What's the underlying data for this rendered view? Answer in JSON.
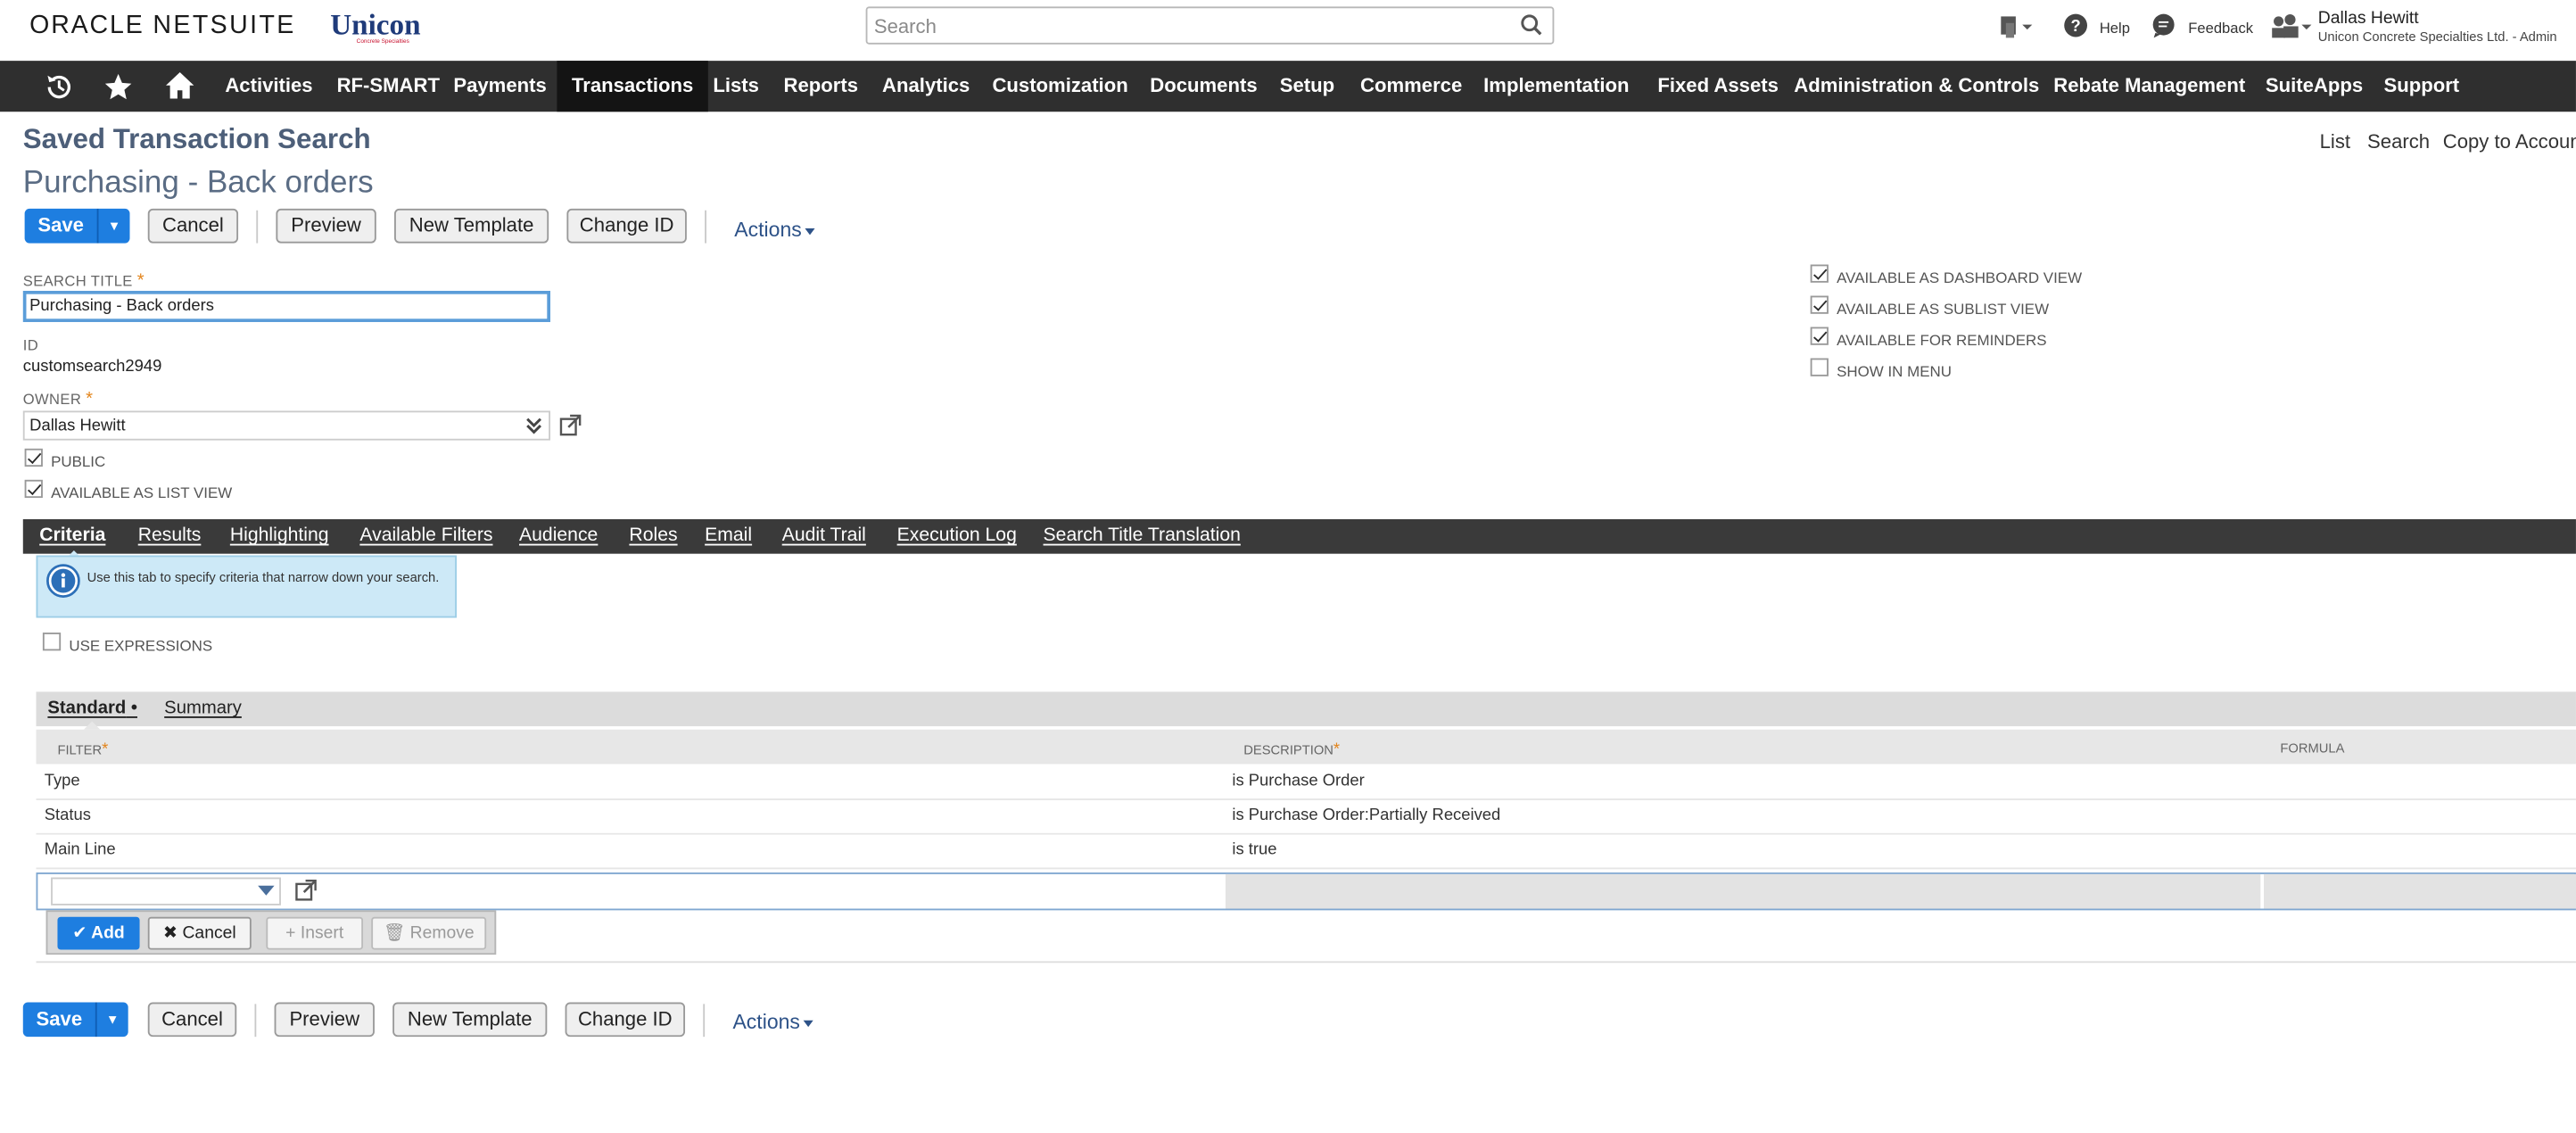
{
  "brand": {
    "oracle": "ORACLE",
    "netsuite": "NETSUITE",
    "company": "Unicon",
    "company_tagline": "Concrete Specialties"
  },
  "search": {
    "placeholder": "Search"
  },
  "header": {
    "help": "Help",
    "feedback": "Feedback",
    "user_name": "Dallas Hewitt",
    "user_company": "Unicon Concrete Specialties Ltd. - Admin"
  },
  "nav": {
    "items": [
      "Activities",
      "RF-SMART",
      "Payments",
      "Transactions",
      "Lists",
      "Reports",
      "Analytics",
      "Customization",
      "Documents",
      "Setup",
      "Commerce",
      "Implementation",
      "Fixed Assets",
      "Administration & Controls",
      "Rebate Management",
      "SuiteApps",
      "Support"
    ],
    "active": "Transactions"
  },
  "page": {
    "title": "Saved Transaction Search",
    "record_title": "Purchasing - Back orders"
  },
  "top_links": {
    "list": "List",
    "search": "Search",
    "copy": "Copy to Account"
  },
  "buttons": {
    "save": "Save",
    "cancel": "Cancel",
    "preview": "Preview",
    "new_template": "New Template",
    "change_id": "Change ID",
    "actions": "Actions"
  },
  "form": {
    "search_title_label": "SEARCH TITLE",
    "search_title_value": "Purchasing - Back orders",
    "id_label": "ID",
    "id_value": "customsearch2949",
    "owner_label": "OWNER",
    "owner_value": "Dallas Hewitt",
    "public_label": "PUBLIC",
    "list_view_label": "AVAILABLE AS LIST VIEW",
    "dashboard_label": "AVAILABLE AS DASHBOARD VIEW",
    "sublist_label": "AVAILABLE AS SUBLIST VIEW",
    "reminders_label": "AVAILABLE FOR REMINDERS",
    "menu_label": "SHOW IN MENU",
    "public_checked": true,
    "list_view_checked": true,
    "dashboard_checked": true,
    "sublist_checked": true,
    "reminders_checked": true,
    "menu_checked": false
  },
  "tabs": [
    "Criteria",
    "Results",
    "Highlighting",
    "Available Filters",
    "Audience",
    "Roles",
    "Email",
    "Audit Trail",
    "Execution Log",
    "Search Title Translation"
  ],
  "criteria": {
    "info": "Use this tab to specify criteria that narrow down your search.",
    "use_expressions": "USE EXPRESSIONS",
    "subtabs": {
      "standard": "Standard",
      "summary": "Summary"
    },
    "columns": {
      "filter": "FILTER",
      "description": "DESCRIPTION",
      "formula": "FORMULA"
    },
    "rows": [
      {
        "filter": "Type",
        "description": "is Purchase Order"
      },
      {
        "filter": "Status",
        "description": "is Purchase Order:Partially Received"
      },
      {
        "filter": "Main Line",
        "description": "is true"
      }
    ],
    "row_buttons": {
      "add": "Add",
      "cancel": "Cancel",
      "insert": "Insert",
      "remove": "Remove"
    }
  }
}
